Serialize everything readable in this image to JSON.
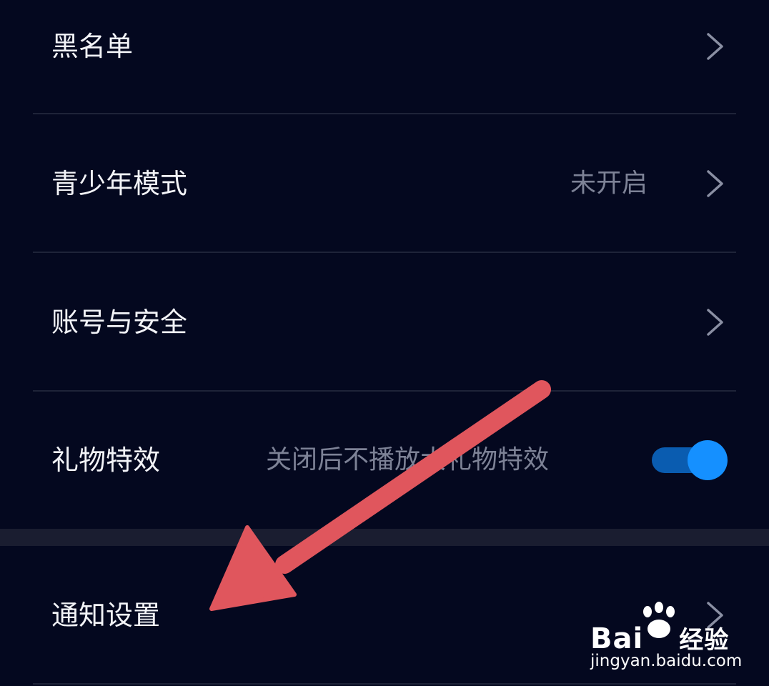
{
  "settings": {
    "blacklist": {
      "label": "黑名单"
    },
    "teen_mode": {
      "label": "青少年模式",
      "value": "未开启"
    },
    "account_security": {
      "label": "账号与安全"
    },
    "gift_effects": {
      "label": "礼物特效",
      "description": "关闭后不播放大礼物特效",
      "enabled": true
    },
    "notification_settings": {
      "label": "通知设置"
    }
  },
  "icons": {
    "chevron": "chevron-right-icon",
    "arrow": "annotation-arrow-icon",
    "paw": "baidu-paw-icon"
  },
  "colors": {
    "background": "#04081f",
    "toggle_on": "#1590ff",
    "arrow": "#e0565d"
  },
  "watermark": {
    "brand": "Bai",
    "brand_tail": "经验",
    "site": "jingyan.baidu.com"
  }
}
